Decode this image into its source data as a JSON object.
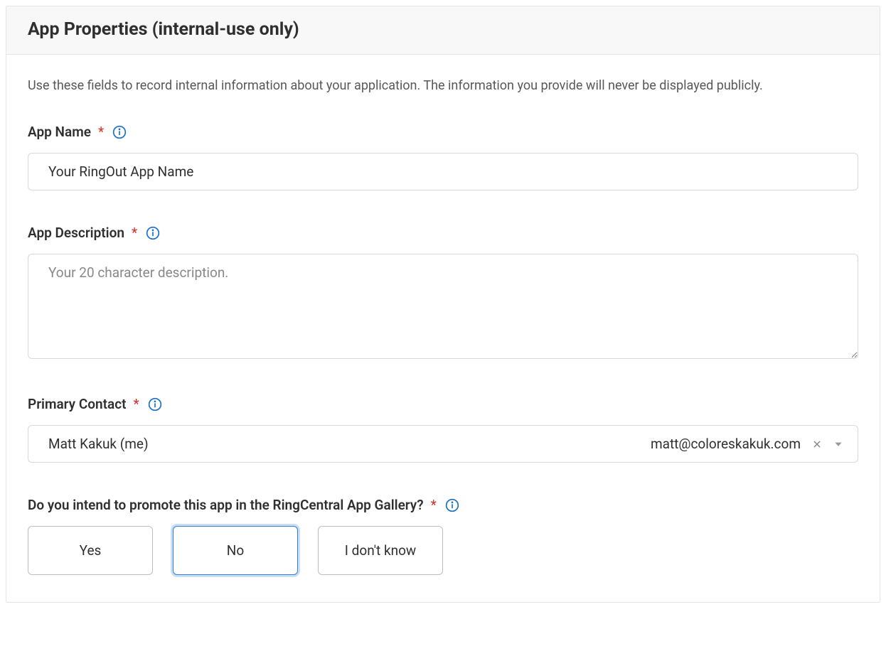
{
  "header": {
    "title": "App Properties (internal-use only)"
  },
  "intro": "Use these fields to record internal information about your application. The information you provide will never be displayed publicly.",
  "fields": {
    "appName": {
      "label": "App Name",
      "value": "Your RingOut App Name"
    },
    "appDescription": {
      "label": "App Description",
      "placeholder": "Your 20 character description."
    },
    "primaryContact": {
      "label": "Primary Contact",
      "name": "Matt Kakuk (me)",
      "email": "matt@coloreskakuk.com"
    },
    "promote": {
      "label": "Do you intend to promote this app in the RingCentral App Gallery?",
      "options": {
        "yes": "Yes",
        "no": "No",
        "dontKnow": "I don't know"
      },
      "selected": "no"
    }
  }
}
